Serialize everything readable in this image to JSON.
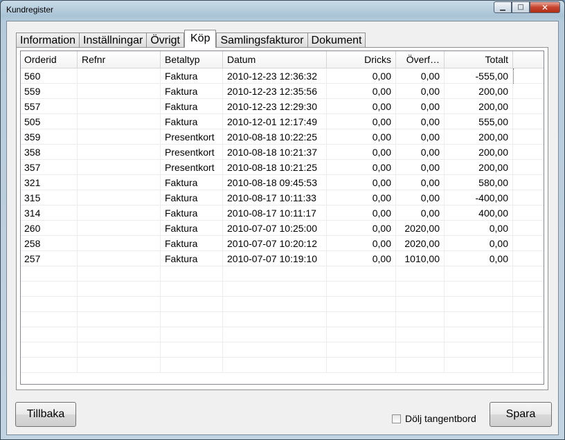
{
  "window": {
    "title": "Kundregister",
    "minimize": "▁",
    "maximize": "□",
    "close": "✕"
  },
  "tabs": [
    {
      "label": "Information"
    },
    {
      "label": "Inställningar"
    },
    {
      "label": "Övrigt"
    },
    {
      "label": "Köp",
      "active": true
    },
    {
      "label": "Samlingsfakturor"
    },
    {
      "label": "Dokument"
    }
  ],
  "table": {
    "columns": [
      "Orderid",
      "Refnr",
      "Betaltyp",
      "Datum",
      "Dricks",
      "Överf…",
      "Totalt"
    ],
    "rows": [
      [
        "560",
        "",
        "Faktura",
        "2010-12-23 12:36:32",
        "0,00",
        "0,00",
        "-555,00"
      ],
      [
        "559",
        "",
        "Faktura",
        "2010-12-23 12:35:56",
        "0,00",
        "0,00",
        "200,00"
      ],
      [
        "557",
        "",
        "Faktura",
        "2010-12-23 12:29:30",
        "0,00",
        "0,00",
        "200,00"
      ],
      [
        "505",
        "",
        "Faktura",
        "2010-12-01 12:17:49",
        "0,00",
        "0,00",
        "555,00"
      ],
      [
        "359",
        "",
        "Presentkort",
        "2010-08-18 10:22:25",
        "0,00",
        "0,00",
        "200,00"
      ],
      [
        "358",
        "",
        "Presentkort",
        "2010-08-18 10:21:37",
        "0,00",
        "0,00",
        "200,00"
      ],
      [
        "357",
        "",
        "Presentkort",
        "2010-08-18 10:21:25",
        "0,00",
        "0,00",
        "200,00"
      ],
      [
        "321",
        "",
        "Faktura",
        "2010-08-18 09:45:53",
        "0,00",
        "0,00",
        "580,00"
      ],
      [
        "315",
        "",
        "Faktura",
        "2010-08-17 10:11:33",
        "0,00",
        "0,00",
        "-400,00"
      ],
      [
        "314",
        "",
        "Faktura",
        "2010-08-17 10:11:17",
        "0,00",
        "0,00",
        "400,00"
      ],
      [
        "260",
        "",
        "Faktura",
        "2010-07-07 10:25:00",
        "0,00",
        "2020,00",
        "0,00"
      ],
      [
        "258",
        "",
        "Faktura",
        "2010-07-07 10:20:12",
        "0,00",
        "2020,00",
        "0,00"
      ],
      [
        "257",
        "",
        "Faktura",
        "2010-07-07 10:19:10",
        "0,00",
        "1010,00",
        "0,00"
      ]
    ]
  },
  "footer": {
    "back_label": "Tillbaka",
    "hide_keyboard_label": "Dölj tangentbord",
    "hide_keyboard_checked": false,
    "save_label": "Spara"
  }
}
